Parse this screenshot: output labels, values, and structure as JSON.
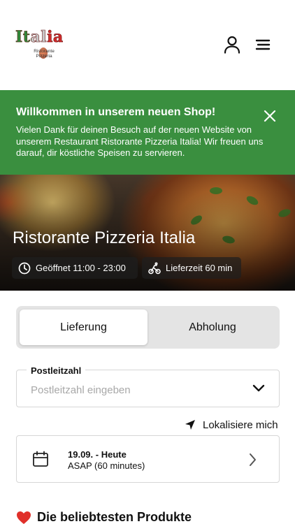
{
  "header": {
    "logo_title": "Italia",
    "logo_subtitle": "Ristorante Pizzeria"
  },
  "banner": {
    "title": "Willkommen in unserem neuen Shop!",
    "text": "Vielen Dank für deinen Besuch auf der neuen Website von unserem Restaurant Ristorante Pizzeria Italia! Wir freuen uns darauf, dir köstliche Speisen zu servieren.",
    "color": "#3a8f3f"
  },
  "hero": {
    "title": "Ristorante Pizzeria Italia",
    "opening_hours": "Geöffnet 11:00 - 23:00",
    "delivery_time": "Lieferzeit 60 min"
  },
  "order_mode": {
    "options": [
      "Lieferung",
      "Abholung"
    ],
    "selected": "Lieferung"
  },
  "postcode": {
    "label": "Postleitzahl",
    "placeholder": "Postleitzahl eingeben",
    "value": ""
  },
  "locate": {
    "label": "Lokalisiere mich"
  },
  "time_slot": {
    "date": "19.09. - Heute",
    "time": "ASAP (60 minutes)"
  },
  "popular": {
    "title": "Die beliebtesten Produkte"
  },
  "icons": {
    "user": "user-icon",
    "menu": "hamburger-menu-icon",
    "close": "close-icon",
    "clock": "clock-icon",
    "bike": "bicycle-icon",
    "chevron_down": "chevron-down-icon",
    "locate": "navigation-arrow-icon",
    "calendar": "calendar-icon",
    "chevron_right": "chevron-right-icon",
    "heart": "heart-icon"
  }
}
